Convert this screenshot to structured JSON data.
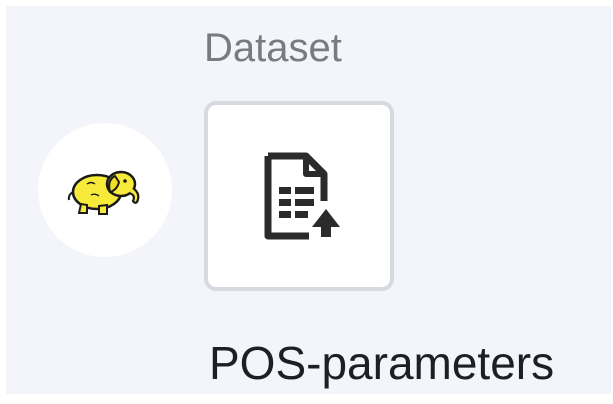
{
  "node": {
    "section_label": "Dataset",
    "name": "POS-parameters",
    "icon": "dataset-upload-icon",
    "source_icon": "hadoop-elephant-icon"
  },
  "colors": {
    "canvas_background": "#f3f5fb",
    "card_border": "#d6dbe1",
    "label_text": "#777b82",
    "name_text": "#1d1f22",
    "icon_dark": "#2b2b2b",
    "elephant_yellow": "#f7ea3a"
  }
}
